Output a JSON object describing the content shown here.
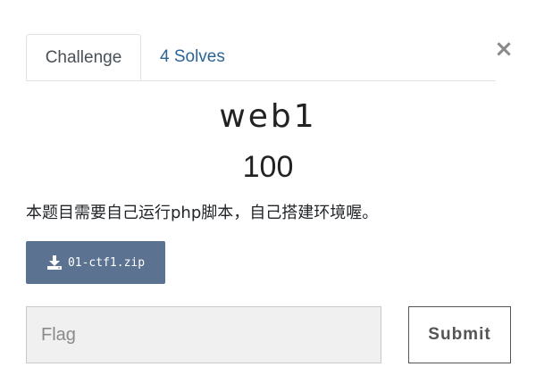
{
  "modal": {
    "close_symbol": "×",
    "tabs": [
      {
        "label": "Challenge",
        "active": true
      },
      {
        "label": "4 Solves",
        "active": false
      }
    ],
    "challenge": {
      "name": "web1",
      "value": "100",
      "description": "本题目需要自己运行php脚本，自己搭建环境喔。",
      "file": {
        "label": "01-ctf1.zip",
        "icon": "download-icon"
      }
    },
    "form": {
      "flag_placeholder": "Flag",
      "flag_value": "",
      "submit_label": "Submit"
    }
  },
  "colors": {
    "download_button": "#5b7290",
    "tab_link": "#2a6496",
    "input_background": "#f0f0f0"
  }
}
